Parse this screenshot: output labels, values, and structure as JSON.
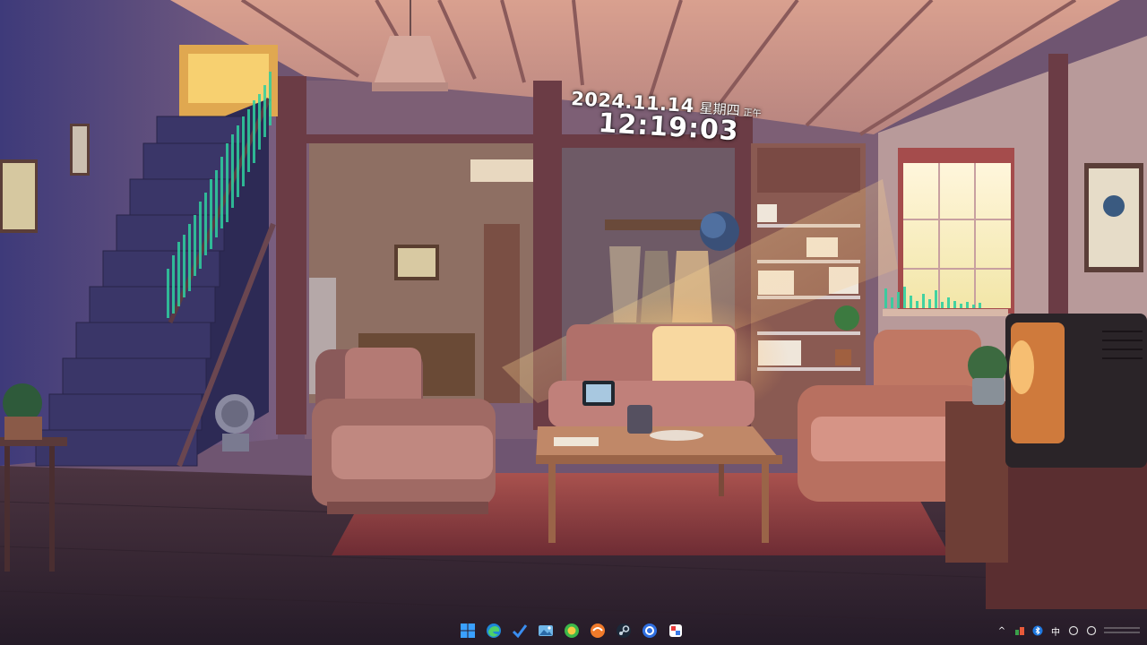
{
  "widget": {
    "date": "2024.11.14",
    "weekday": "星期四",
    "ampm": "正午",
    "time": "12:19:03"
  },
  "taskbar": {
    "apps": [
      {
        "name": "start",
        "icon": "windows-logo-icon"
      },
      {
        "name": "edge",
        "icon": "edge-icon"
      },
      {
        "name": "todo",
        "icon": "checkmark-icon"
      },
      {
        "name": "photos",
        "icon": "photos-icon"
      },
      {
        "name": "360",
        "icon": "app-360-icon"
      },
      {
        "name": "app-orange",
        "icon": "orange-app-icon"
      },
      {
        "name": "steam",
        "icon": "steam-icon"
      },
      {
        "name": "app-blue",
        "icon": "blue-app-icon"
      },
      {
        "name": "app-paint",
        "icon": "paint-icon"
      }
    ],
    "tray": {
      "chevron": "^",
      "ime": "中"
    }
  },
  "colors": {
    "ceiling": "#c98d84",
    "wall": "#8b6a86",
    "floor": "#3a2a36",
    "sunlight": "#ffd27a",
    "equalizer": "#2fd0a0",
    "accent_blue": "#1e90ff"
  }
}
